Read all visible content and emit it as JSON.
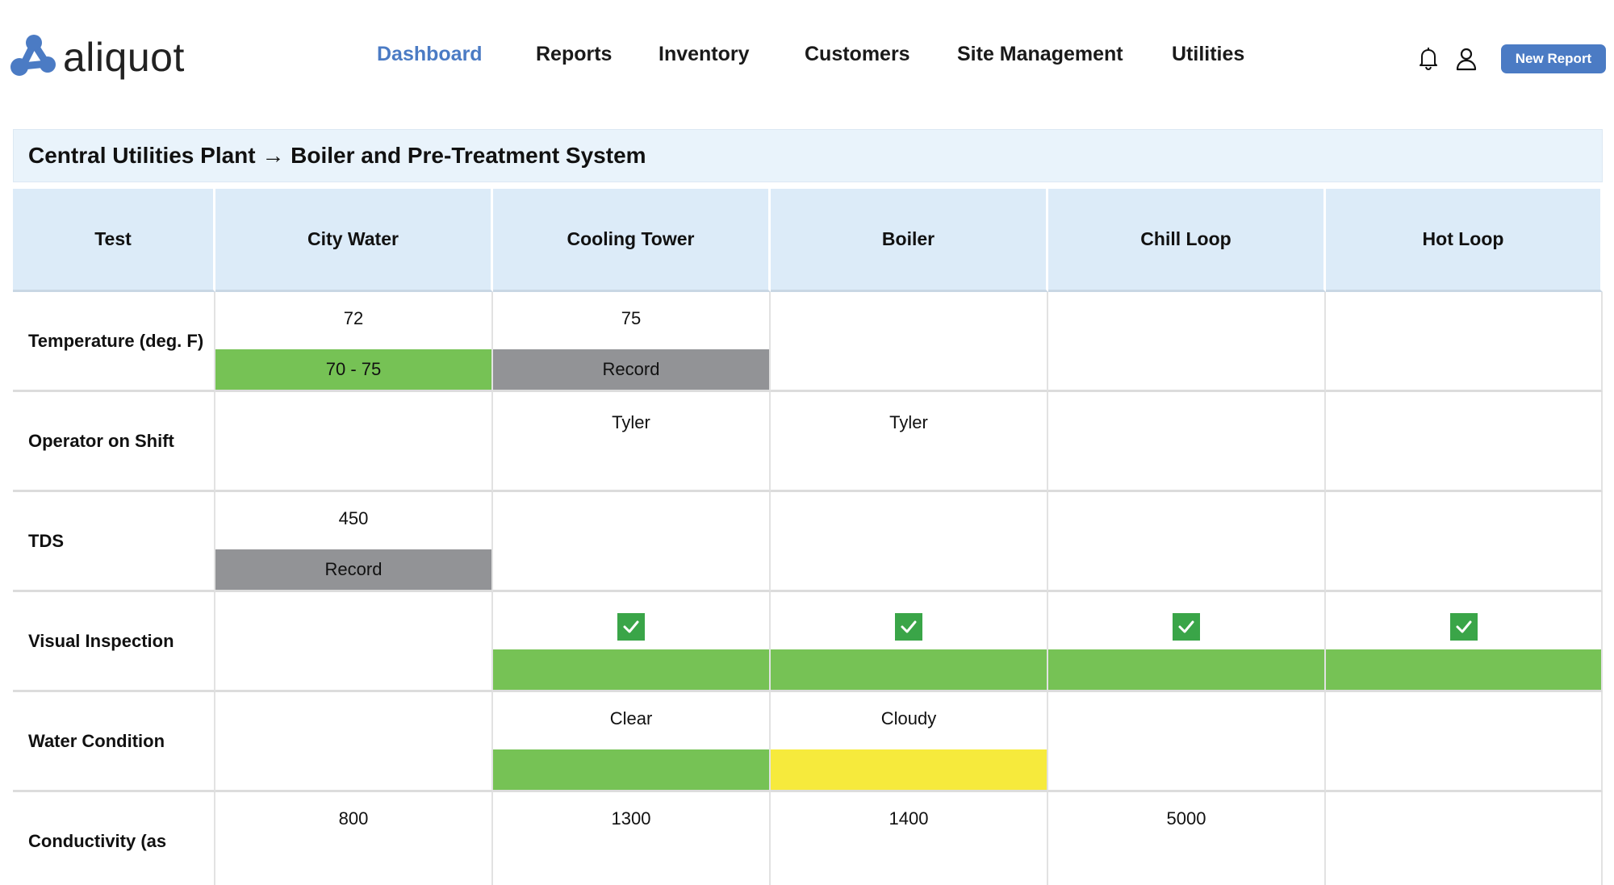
{
  "header": {
    "logo_text": "aliquot",
    "nav": [
      {
        "label": "Dashboard",
        "active": true
      },
      {
        "label": "Reports",
        "active": false
      },
      {
        "label": "Inventory",
        "active": false
      },
      {
        "label": "Customers",
        "active": false
      },
      {
        "label": "Site Management",
        "active": false
      },
      {
        "label": "Utilities",
        "active": false
      }
    ],
    "icons": [
      "bell-icon",
      "user-icon"
    ],
    "new_report_label": "New Report",
    "accent_color": "#4b7bc4"
  },
  "breadcrumb": "Central Utilities Plant → Boiler and Pre-Treatment System",
  "table": {
    "columns": [
      "Test",
      "City Water",
      "Cooling Tower",
      "Boiler",
      "Chill Loop",
      "Hot Loop"
    ],
    "rows": [
      {
        "label": "Temperature (deg. F)",
        "cells": [
          {
            "value": "72",
            "band": "70 - 75",
            "band_color": "green"
          },
          {
            "value": "75",
            "band": "Record",
            "band_color": "grey"
          },
          {},
          {},
          {}
        ]
      },
      {
        "label": "Operator on Shift",
        "cells": [
          {},
          {
            "value": "Tyler"
          },
          {
            "value": "Tyler"
          },
          {},
          {}
        ]
      },
      {
        "label": "TDS",
        "cells": [
          {
            "value": "450",
            "band": "Record",
            "band_color": "grey"
          },
          {},
          {},
          {},
          {}
        ]
      },
      {
        "label": "Visual Inspection",
        "cells": [
          {},
          {
            "checked": true,
            "band": "",
            "band_color": "green"
          },
          {
            "checked": true,
            "band": "",
            "band_color": "green"
          },
          {
            "checked": true,
            "band": "",
            "band_color": "green"
          },
          {
            "checked": true,
            "band": "",
            "band_color": "green"
          }
        ]
      },
      {
        "label": "Water Condition",
        "cells": [
          {},
          {
            "value": "Clear",
            "band": "",
            "band_color": "green"
          },
          {
            "value": "Cloudy",
            "band": "",
            "band_color": "yellow"
          },
          {},
          {}
        ]
      },
      {
        "label": "Conductivity (as",
        "cells": [
          {
            "value": "800"
          },
          {
            "value": "1300"
          },
          {
            "value": "1400"
          },
          {
            "value": "5000"
          },
          {}
        ]
      }
    ],
    "status_colors": {
      "green": "#76c255",
      "grey": "#929396",
      "yellow": "#f6ea3c",
      "check": "#3aa548"
    }
  }
}
